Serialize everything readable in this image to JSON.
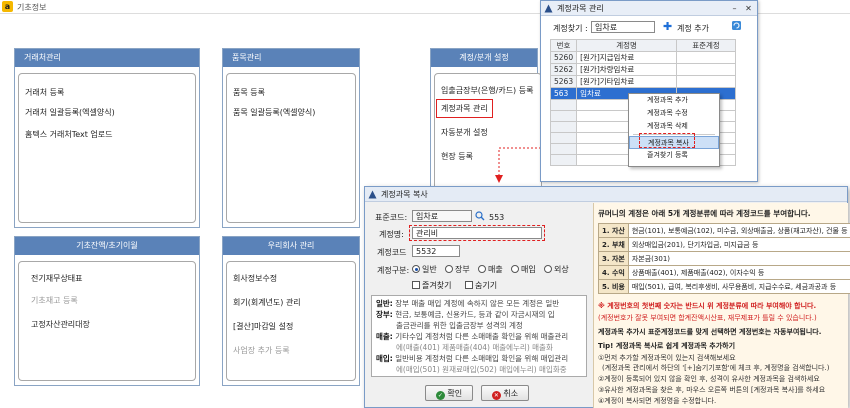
{
  "main_window": {
    "logo_letter": "a",
    "title": "기초정보"
  },
  "panels": {
    "customer": {
      "header": "거래처관리",
      "items": [
        "거래처 등록",
        "거래처 일괄등록(엑셀양식)",
        "홈텍스 거래처Text 업로드"
      ]
    },
    "product": {
      "header": "품목관리",
      "items": [
        "품목 등록",
        "품목 일괄등록(엑셀양식)"
      ]
    },
    "account_setup": {
      "header": "계정/분개 설정",
      "items": [
        "입출금장부(은행/카드) 등록",
        "계정과목 관리",
        "자동분개 설정",
        "현장 등록"
      ]
    },
    "opening": {
      "header": "기초잔액/초기이월",
      "items": [
        "전기재무상태표",
        "기초재고 등록",
        "고정자산관리대장"
      ]
    },
    "company": {
      "header": "우리회사 관리",
      "items": [
        "회사정보수정",
        "회기(회계년도) 관리",
        "[결산]마감일 설정",
        "사업장 추가 등록"
      ]
    }
  },
  "account_manage": {
    "title": "계정과목 관리",
    "search_label": "계정찾기 :",
    "search_value": "임차료",
    "add_label": "계정 추가",
    "columns": [
      "번호",
      "계정명",
      "표준계정"
    ],
    "rows": [
      {
        "num": "5260",
        "name": "[원가]지급임차료",
        "std": ""
      },
      {
        "num": "5262",
        "name": "[원가]차량임차료",
        "std": ""
      },
      {
        "num": "5263",
        "name": "[원가]기타임차료",
        "std": ""
      },
      {
        "num": "563",
        "name": "임차료",
        "std": ""
      }
    ],
    "context_menu": [
      "계정과목 추가",
      "계정과목 수정",
      "계정과목 삭제",
      "계정과목 복사",
      "즐겨찾기 등록"
    ]
  },
  "copy_dialog": {
    "title": "계정과목 복사",
    "std_code_label": "표준코드:",
    "std_code_value": "임차료",
    "std_code_num": "553",
    "name_label": "계정명:",
    "name_value": "관리비",
    "code_label": "계정코드",
    "code_value": "5532",
    "type_label": "계정구분:",
    "type_options": [
      "일반",
      "장부",
      "매출",
      "매입",
      "외상"
    ],
    "favorite_label": "즐겨찾기",
    "hide_label": "숨기기",
    "desc": [
      {
        "k": "일반:",
        "v": "장부 매출 매입 계정에 속하지 않은 모든 계정은 일반"
      },
      {
        "k": "장부:",
        "v": "현금, 보통예금, 신용카드, 등과 같이 자금시재의 입"
      },
      {
        "k": "",
        "v": "출금관리를 위한 입출금장부 성격의 계정"
      },
      {
        "k": "매출:",
        "v": "기타수입 계정처럼 다른 소매매출 확인을 위해 매출관리"
      },
      {
        "k": "",
        "v": "에(매출(401) 제품매출(404) 매출에누리) 매출화"
      },
      {
        "k": "매입:",
        "v": "일반비용 계정처럼 다른 소매매입 확인을 위해 매입관리"
      },
      {
        "k": "",
        "v": "에(매입(501) 원재료매입(502) 매입에누리) 매입화중"
      }
    ],
    "ok_label": "확인",
    "cancel_label": "취소"
  },
  "help": {
    "heading": "큐머니의 계정은 아래 5개 계정분류에 따라 계정코드를 부여합니다.",
    "categories": [
      {
        "k": "1. 자산",
        "v": "현금(101), 보통예금(102), 미수금, 외상매출금, 상품(재고자산), 건물 등"
      },
      {
        "k": "2. 부채",
        "v": "외상매입금(201), 단기차입금, 미지급금 등"
      },
      {
        "k": "3. 자본",
        "v": "자본금(301)"
      },
      {
        "k": "4. 수익",
        "v": "상품매출(401), 제품매출(402), 이자수익 등"
      },
      {
        "k": "5. 비용",
        "v": "매입(501), 급여, 복리후생비, 사무용품비, 지급수수료, 세금과공과 등"
      }
    ],
    "note_red": "※ 계정번호의 첫번째 숫자는 반드시 위 계정분류에 따라 부여해야 합니다.",
    "note_red2": "(계정번호가 잘못 부여되면 합계잔액시산표, 재무제표가 틀릴 수 있습니다.)",
    "note_bold": "계정과목 추가시 표준계정코드를 맞게 선택하면 계정번호는 자동부여됩니다.",
    "tip_title": "Tip! 계정과목 복사로 쉽게 계정과목 추가하기",
    "tips": [
      "①먼저 추가할 계정과목이 있는지 검색해보세요",
      "(계정과목 관리에서 하단의 '[+]숨기기포함'에 체크 후, 계정명을 검색합니다.)",
      "②계정이 등록되어 있지 않을 확인 후, 성격이 유사한 계정과목을 검색하세요",
      "③유사한 계정과목을 찾은 후, 마우스 오른쪽 버튼의 [계정과목 복사]를 하세요",
      "④계정이 복사되면 계정명을 수정합니다."
    ]
  },
  "colors": {
    "panel_header": "#5a82b8",
    "highlight_red": "#e02020",
    "selection_blue": "#2d6fd0",
    "help_bg": "#fff7e8"
  }
}
